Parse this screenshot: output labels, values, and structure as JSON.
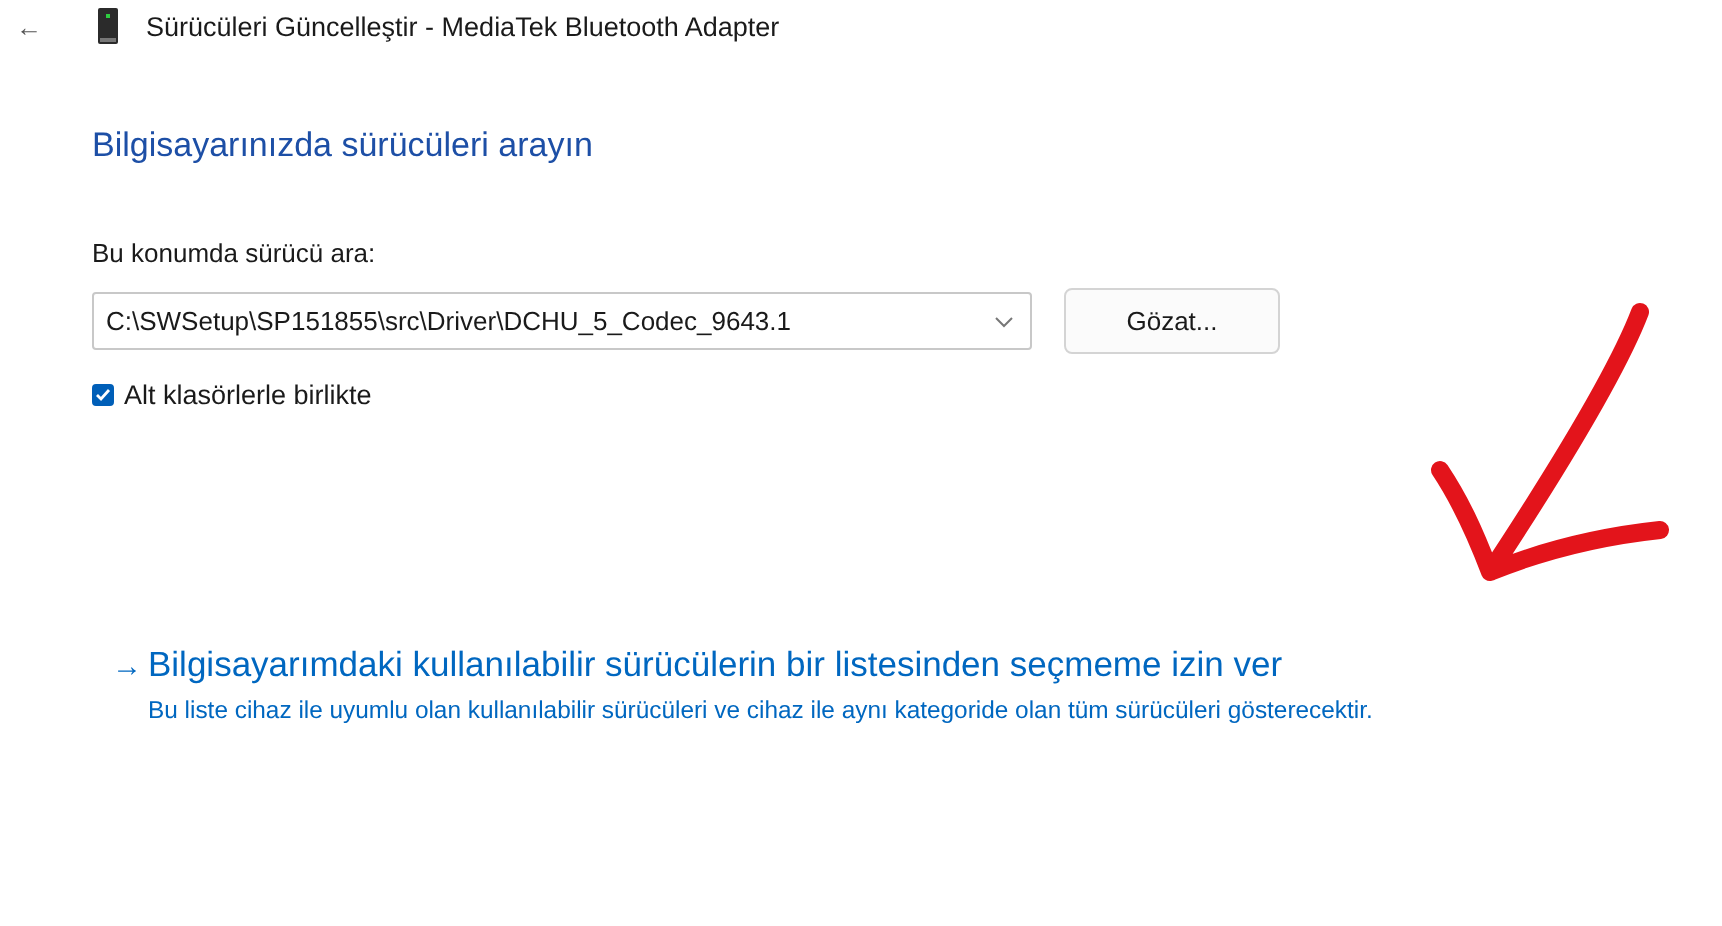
{
  "window": {
    "back": "←",
    "title": "Sürücüleri Güncelleştir - MediaTek Bluetooth Adapter"
  },
  "heading": "Bilgisayarınızda sürücüleri arayın",
  "location": {
    "label": "Bu konumda sürücü ara:",
    "value": "C:\\SWSetup\\SP151855\\src\\Driver\\DCHU_5_Codec_9643.1",
    "browse": "Gözat..."
  },
  "include_subfolders": {
    "label": "Alt klasörlerle birlikte",
    "checked": true
  },
  "pick_link": {
    "arrow": "→",
    "label": "Bilgisayarımdaki kullanılabilir sürücülerin bir listesinden seçmeme izin ver",
    "description": "Bu liste cihaz ile uyumlu olan kullanılabilir sürücüleri ve cihaz ile aynı kategoride olan tüm sürücüleri gösterecektir."
  }
}
